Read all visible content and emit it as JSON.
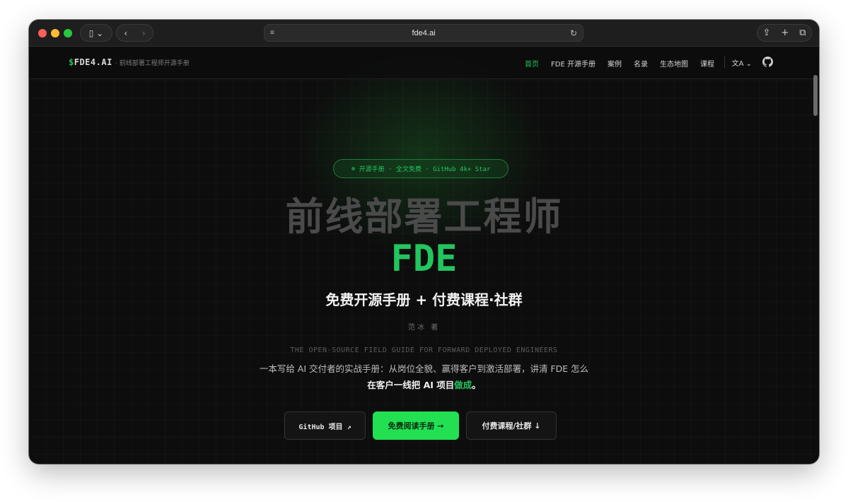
{
  "browser": {
    "url": "fde4.ai"
  },
  "site": {
    "logo_prefix": "$",
    "logo_text": "FDE4.AI",
    "tagline": "· 前线部署工程师开源手册",
    "menu": [
      {
        "label": "首页",
        "active": true
      },
      {
        "label": "FDE 开源手册",
        "active": false
      },
      {
        "label": "案例",
        "active": false
      },
      {
        "label": "名录",
        "active": false
      },
      {
        "label": "生态地图",
        "active": false
      },
      {
        "label": "课程",
        "active": false
      }
    ],
    "lang_label": "文A ⌄"
  },
  "hero": {
    "badge": "开源手册 · 全文免费 · GitHub 4k+ Star",
    "title": "前线部署工程师",
    "title_accent": "FDE",
    "subtitle": "免费开源手册 + 付费课程·社群",
    "author": "范冰 著",
    "en_line": "THE OPEN-SOURCE FIELD GUIDE FOR FORWARD DEPLOYED ENGINEERS",
    "desc_line1": "一本写给 AI 交付者的实战手册：从岗位全貌、赢得客户到激活部署，讲清 FDE 怎么",
    "desc_line2_pre": "在客户一线把 AI 项目",
    "desc_line2_hl": "做成",
    "desc_line2_post": "。"
  },
  "buttons": {
    "github": "GitHub 项目 ↗",
    "read": "免费阅读手册 →",
    "paid": "付费课程/社群 ↓"
  },
  "colors": {
    "accent": "#22c55e",
    "background": "#0d0d0d"
  }
}
